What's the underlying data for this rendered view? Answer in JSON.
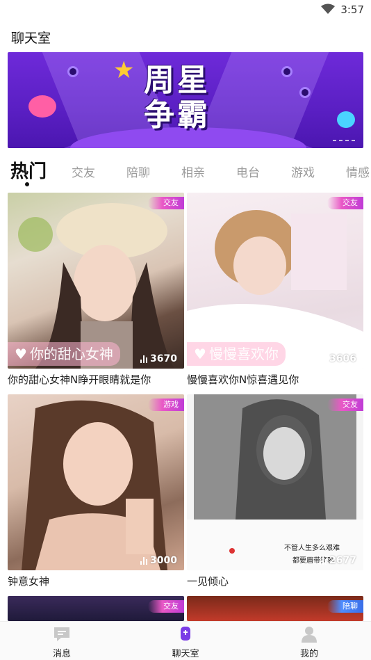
{
  "status_bar": {
    "time": "3:57"
  },
  "app": {
    "title": "聊天室"
  },
  "banner": {
    "line1": "周星",
    "line2": "争霸"
  },
  "tabs": [
    {
      "label": "热门",
      "active": true
    },
    {
      "label": "交友"
    },
    {
      "label": "陪聊"
    },
    {
      "label": "相亲"
    },
    {
      "label": "电台"
    },
    {
      "label": "游戏"
    },
    {
      "label": "情感"
    }
  ],
  "rooms": [
    {
      "badge": "交友",
      "views": "3670",
      "caption": "你的甜心女神N睁开眼睛就是你",
      "overlay": "你的甜心女神"
    },
    {
      "badge": "交友",
      "views": "3606",
      "caption": "慢慢喜欢你N惊喜遇见你",
      "overlay": "慢慢喜欢你"
    },
    {
      "badge": "游戏",
      "views": "3000",
      "caption": "钟意女神"
    },
    {
      "badge": "交友",
      "views": "2677",
      "caption": "一见倾心",
      "poster_text_1": "不管人生多么艰难",
      "poster_text_2": "都要眉带笑容"
    },
    {
      "badge": "交友"
    },
    {
      "badge": "陪聊"
    }
  ],
  "nav": {
    "messages": "消息",
    "chatroom": "聊天室",
    "me": "我的"
  },
  "colors": {
    "badge_pink": "#e958c6",
    "badge_blue": "#4e8dff",
    "banner_purple": "#6e2ad9",
    "nav_active": "#7b3ce6",
    "nav_inactive": "#c8c8c8"
  }
}
